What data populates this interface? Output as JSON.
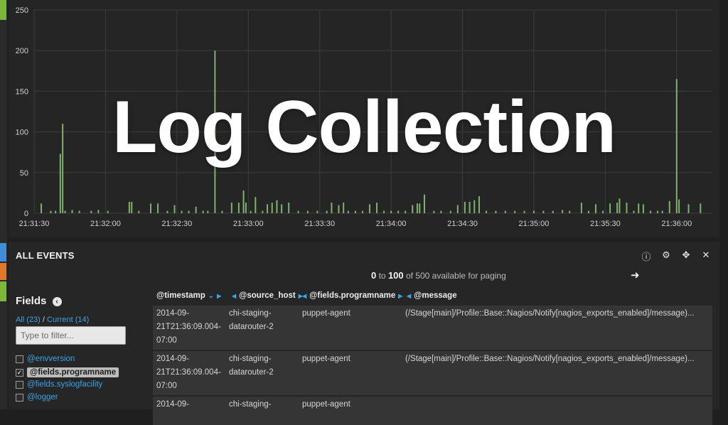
{
  "overlay_title": "Log Collection",
  "chart_data": {
    "type": "bar",
    "title": "",
    "xlabel": "",
    "ylabel": "",
    "ylim": [
      0,
      250
    ],
    "yticks": [
      0,
      50,
      100,
      150,
      200,
      250
    ],
    "xtick_labels": [
      "21:31:30",
      "21:32:00",
      "21:32:30",
      "21:33:00",
      "21:33:30",
      "21:34:00",
      "21:34:30",
      "21:35:00",
      "21:35:30",
      "21:36:00"
    ],
    "x_range_seconds": [
      0,
      285
    ],
    "grid": true,
    "bar_color": "#7eb26d",
    "bars": [
      [
        3,
        12
      ],
      [
        7,
        3
      ],
      [
        9,
        3
      ],
      [
        11,
        73
      ],
      [
        12,
        110
      ],
      [
        13,
        3
      ],
      [
        16,
        4
      ],
      [
        19,
        3
      ],
      [
        24,
        3
      ],
      [
        27,
        4
      ],
      [
        31,
        3
      ],
      [
        40,
        14
      ],
      [
        41,
        14
      ],
      [
        44,
        3
      ],
      [
        49,
        12
      ],
      [
        52,
        12
      ],
      [
        56,
        3
      ],
      [
        59,
        10
      ],
      [
        62,
        3
      ],
      [
        65,
        3
      ],
      [
        68,
        8
      ],
      [
        71,
        3
      ],
      [
        73,
        3
      ],
      [
        76,
        200
      ],
      [
        79,
        3
      ],
      [
        83,
        13
      ],
      [
        86,
        13
      ],
      [
        88,
        28
      ],
      [
        89,
        13
      ],
      [
        91,
        3
      ],
      [
        93,
        20
      ],
      [
        96,
        3
      ],
      [
        98,
        11
      ],
      [
        100,
        13
      ],
      [
        102,
        16
      ],
      [
        104,
        11
      ],
      [
        107,
        13
      ],
      [
        111,
        3
      ],
      [
        115,
        3
      ],
      [
        119,
        3
      ],
      [
        123,
        3
      ],
      [
        125,
        13
      ],
      [
        128,
        10
      ],
      [
        130,
        13
      ],
      [
        132,
        3
      ],
      [
        135,
        3
      ],
      [
        138,
        3
      ],
      [
        141,
        11
      ],
      [
        144,
        13
      ],
      [
        147,
        3
      ],
      [
        150,
        3
      ],
      [
        153,
        3
      ],
      [
        156,
        3
      ],
      [
        159,
        10
      ],
      [
        161,
        12
      ],
      [
        162,
        12
      ],
      [
        164,
        23
      ],
      [
        168,
        3
      ],
      [
        171,
        3
      ],
      [
        175,
        3
      ],
      [
        178,
        10
      ],
      [
        181,
        14
      ],
      [
        183,
        14
      ],
      [
        185,
        16
      ],
      [
        187,
        21
      ],
      [
        190,
        3
      ],
      [
        194,
        3
      ],
      [
        198,
        3
      ],
      [
        202,
        3
      ],
      [
        206,
        3
      ],
      [
        210,
        3
      ],
      [
        214,
        3
      ],
      [
        218,
        3
      ],
      [
        222,
        4
      ],
      [
        225,
        3
      ],
      [
        230,
        13
      ],
      [
        233,
        3
      ],
      [
        236,
        11
      ],
      [
        239,
        3
      ],
      [
        242,
        12
      ],
      [
        245,
        13
      ],
      [
        246,
        18
      ],
      [
        249,
        13
      ],
      [
        252,
        3
      ],
      [
        254,
        12
      ],
      [
        256,
        11
      ],
      [
        259,
        3
      ],
      [
        262,
        3
      ],
      [
        264,
        3
      ],
      [
        267,
        15
      ],
      [
        270,
        165
      ],
      [
        271,
        17
      ],
      [
        275,
        11
      ],
      [
        280,
        12
      ]
    ]
  },
  "events": {
    "title": "ALL EVENTS",
    "paging": {
      "from": "0",
      "to_word": "to",
      "to": "100",
      "suffix": "of 500 available for paging"
    },
    "icons": [
      "info-icon",
      "gear-icon",
      "move-icon",
      "close-icon"
    ],
    "fields": {
      "title": "Fields",
      "all": "All (23)",
      "slash": "/",
      "current": "Current (14)",
      "filter_placeholder": "Type to filter...",
      "items": [
        {
          "label": "@envversion",
          "checked": false
        },
        {
          "label": "@fields.programname",
          "checked": true
        },
        {
          "label": "@fields.syslogfacility",
          "checked": false
        },
        {
          "label": "@logger",
          "checked": false
        }
      ]
    },
    "columns": [
      "@timestamp",
      "@source_host",
      "@fields.programname",
      "@message"
    ],
    "rows": [
      {
        "timestamp": [
          "2014-09-",
          "21T21:36:09.004-",
          "07:00"
        ],
        "source_host": [
          "chi-staging-",
          "datarouter-2"
        ],
        "programname": "puppet-agent",
        "message": "(/Stage[main]/Profile::Base::Nagios/Notify[nagios_exports_enabled]/message)..."
      },
      {
        "timestamp": [
          "2014-09-",
          "21T21:36:09.004-",
          "07:00"
        ],
        "source_host": [
          "chi-staging-",
          "datarouter-2"
        ],
        "programname": "puppet-agent",
        "message": "(/Stage[main]/Profile::Base::Nagios/Notify[nagios_exports_enabled]/message)..."
      },
      {
        "timestamp": [
          "2014-09-"
        ],
        "source_host": [
          "chi-staging-"
        ],
        "programname": "puppet-agent",
        "message": ""
      }
    ]
  }
}
